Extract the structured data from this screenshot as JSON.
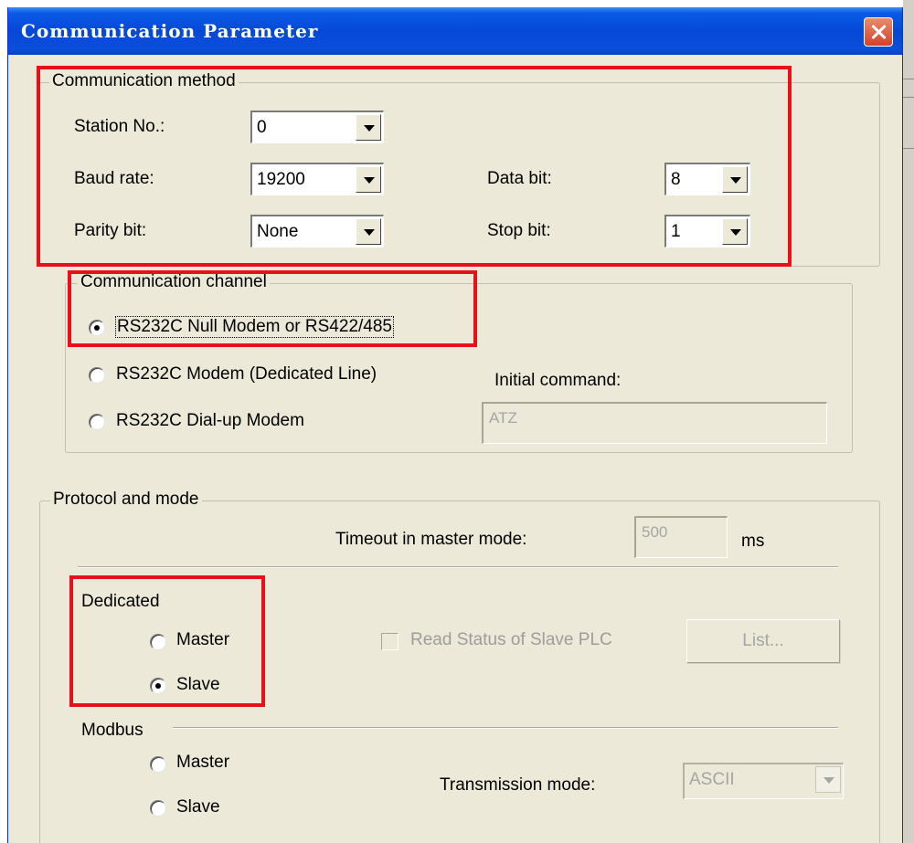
{
  "window": {
    "title": "Communication Parameter",
    "close_icon": "close-icon"
  },
  "communication_method": {
    "group_title": "Communication method",
    "station_no": {
      "label": "Station No.:",
      "value": "0"
    },
    "baud_rate": {
      "label": "Baud rate:",
      "value": "19200"
    },
    "parity_bit": {
      "label": "Parity bit:",
      "value": "None"
    },
    "data_bit": {
      "label": "Data bit:",
      "value": "8"
    },
    "stop_bit": {
      "label": "Stop bit:",
      "value": "1"
    }
  },
  "communication_channel": {
    "group_title": "Communication channel",
    "options": [
      {
        "label": "RS232C Null Modem or RS422/485",
        "selected": true
      },
      {
        "label": "RS232C Modem (Dedicated Line)",
        "selected": false
      },
      {
        "label": "RS232C Dial-up Modem",
        "selected": false
      }
    ],
    "initial_command_label": "Initial command:",
    "initial_command_value": "ATZ"
  },
  "protocol_and_mode": {
    "group_title": "Protocol and mode",
    "timeout_label": "Timeout in master mode:",
    "timeout_value": "500",
    "timeout_unit": "ms",
    "dedicated": {
      "label": "Dedicated",
      "master_label": "Master",
      "master_selected": false,
      "slave_label": "Slave",
      "slave_selected": true
    },
    "read_status_label": "Read Status of Slave PLC",
    "read_status_checked": false,
    "list_button_label": "List...",
    "modbus": {
      "label": "Modbus",
      "master_label": "Master",
      "master_selected": false,
      "slave_label": "Slave",
      "slave_selected": false
    },
    "transmission_mode_label": "Transmission mode:",
    "transmission_mode_value": "ASCII"
  },
  "colors": {
    "titlebar": "#0548d8",
    "dialog_face": "#ece9d8",
    "annotation_red": "#e8101a",
    "disabled_text": "#a5a5a5"
  }
}
